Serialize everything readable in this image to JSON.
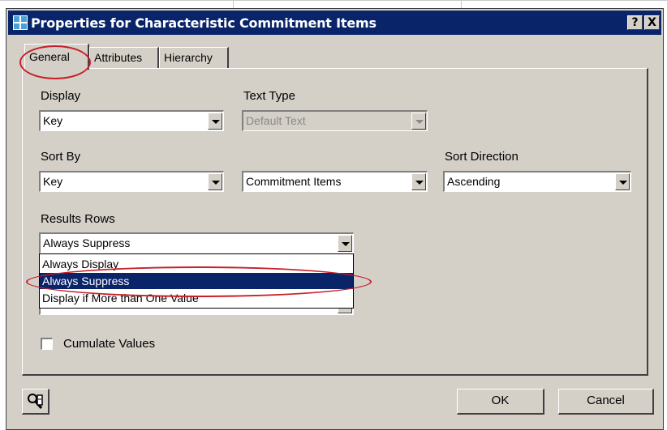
{
  "window": {
    "title": "Properties for Characteristic Commitment Items",
    "help_label": "?",
    "close_label": "X",
    "icon": "grid-icon"
  },
  "tabs": [
    {
      "label": "General",
      "active": true
    },
    {
      "label": "Attributes",
      "active": false
    },
    {
      "label": "Hierarchy",
      "active": false
    }
  ],
  "general": {
    "display": {
      "label": "Display",
      "value": "Key"
    },
    "text_type": {
      "label": "Text Type",
      "value": "Default Text",
      "disabled": true
    },
    "sort_by": {
      "label": "Sort By",
      "value": "Key",
      "secondary_value": "Commitment Items"
    },
    "sort_direction": {
      "label": "Sort Direction",
      "value": "Ascending"
    },
    "results_rows": {
      "label": "Results Rows",
      "value": "Always Suppress",
      "options": [
        "Always Display",
        "Always Suppress",
        "Display if More than One Value"
      ],
      "highlighted_index": 1
    },
    "cumulate": {
      "label": "Cumulate Values",
      "checked": false
    }
  },
  "footer": {
    "settings_icon": "wrench-key-icon",
    "ok_label": "OK",
    "cancel_label": "Cancel"
  },
  "annotations": {
    "highlight_color": "#c8202a"
  },
  "colors": {
    "titlebar": "#0a246a",
    "dialog_face": "#d4d0c8",
    "selection": "#0a246a"
  }
}
